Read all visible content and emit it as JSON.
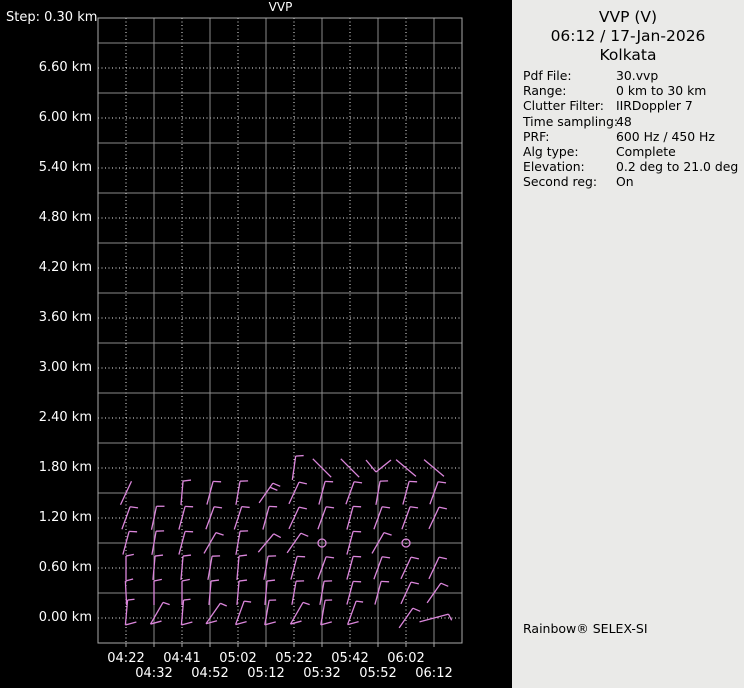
{
  "plot": {
    "title": "VVP",
    "step_label": "Step: 0.30 km",
    "y_axis": {
      "unit": "km",
      "labels": [
        "6.60 km",
        "6.00 km",
        "5.40 km",
        "4.80 km",
        "4.20 km",
        "3.60 km",
        "3.00 km",
        "2.40 km",
        "1.80 km",
        "1.20 km",
        "0.60 km",
        "0.00 km"
      ]
    },
    "x_axis": {
      "labels_row1": [
        "04:22",
        "04:41",
        "05:02",
        "05:22",
        "05:42",
        "06:02"
      ],
      "labels_row2": [
        "04:32",
        "04:52",
        "05:12",
        "05:32",
        "05:52",
        "06:12"
      ]
    }
  },
  "chart_data": {
    "type": "wind-barb-time-height-profile",
    "x_times": [
      "04:22",
      "04:32",
      "04:41",
      "04:52",
      "05:02",
      "05:12",
      "05:22",
      "05:32",
      "05:42",
      "05:52",
      "06:02",
      "06:12"
    ],
    "y_heights_km": [
      0.0,
      0.3,
      0.6,
      0.9,
      1.2,
      1.5,
      1.8
    ],
    "height_step_km": 0.3,
    "y_axis_range_km": [
      0.0,
      7.2
    ],
    "grid": "solid lines every 0.6 km / 20 min, dotted lines every 0.3 km / 10 min",
    "barb_note": "s=shape (barb: staff+tick, barb2: staff+2 ticks, line: plain staff, circle: calm, hook: staff+foot, dash: near-horizontal staff, vee: v-shape), a=staff tilt deg clockwise from vertical, t=time index, h=height km",
    "barbs": [
      {
        "h": 1.8,
        "t": 6,
        "s": "barb",
        "a": 8
      },
      {
        "h": 1.8,
        "t": 7,
        "s": "line",
        "a": -45
      },
      {
        "h": 1.8,
        "t": 8,
        "s": "line",
        "a": -45
      },
      {
        "h": 1.8,
        "t": 9,
        "s": "vee",
        "a": 0
      },
      {
        "h": 1.8,
        "t": 10,
        "s": "line",
        "a": -50
      },
      {
        "h": 1.8,
        "t": 11,
        "s": "line",
        "a": -50
      },
      {
        "h": 1.5,
        "t": 0,
        "s": "line",
        "a": 25
      },
      {
        "h": 1.5,
        "t": 2,
        "s": "barb",
        "a": 5
      },
      {
        "h": 1.5,
        "t": 3,
        "s": "barb",
        "a": 15
      },
      {
        "h": 1.5,
        "t": 4,
        "s": "barb",
        "a": 10
      },
      {
        "h": 1.5,
        "t": 5,
        "s": "barb2",
        "a": 35
      },
      {
        "h": 1.5,
        "t": 6,
        "s": "barb",
        "a": 25
      },
      {
        "h": 1.5,
        "t": 7,
        "s": "barb",
        "a": 15
      },
      {
        "h": 1.5,
        "t": 8,
        "s": "barb",
        "a": 20
      },
      {
        "h": 1.5,
        "t": 9,
        "s": "barb",
        "a": 10
      },
      {
        "h": 1.5,
        "t": 10,
        "s": "barb",
        "a": 15
      },
      {
        "h": 1.5,
        "t": 11,
        "s": "barb",
        "a": 20
      },
      {
        "h": 1.2,
        "t": 0,
        "s": "barb",
        "a": 20
      },
      {
        "h": 1.2,
        "t": 1,
        "s": "barb",
        "a": 12
      },
      {
        "h": 1.2,
        "t": 2,
        "s": "barb",
        "a": 15
      },
      {
        "h": 1.2,
        "t": 3,
        "s": "barb",
        "a": 20
      },
      {
        "h": 1.2,
        "t": 4,
        "s": "barb",
        "a": 18
      },
      {
        "h": 1.2,
        "t": 5,
        "s": "barb",
        "a": 15
      },
      {
        "h": 1.2,
        "t": 6,
        "s": "barb",
        "a": 25
      },
      {
        "h": 1.2,
        "t": 7,
        "s": "barb",
        "a": 20
      },
      {
        "h": 1.2,
        "t": 8,
        "s": "barb",
        "a": 15
      },
      {
        "h": 1.2,
        "t": 9,
        "s": "barb",
        "a": 20
      },
      {
        "h": 1.2,
        "t": 10,
        "s": "barb",
        "a": 20
      },
      {
        "h": 1.2,
        "t": 11,
        "s": "barb",
        "a": 25
      },
      {
        "h": 0.9,
        "t": 0,
        "s": "barb",
        "a": 15
      },
      {
        "h": 0.9,
        "t": 1,
        "s": "barb",
        "a": 10
      },
      {
        "h": 0.9,
        "t": 2,
        "s": "barb",
        "a": 15
      },
      {
        "h": 0.9,
        "t": 3,
        "s": "barb",
        "a": 30
      },
      {
        "h": 0.9,
        "t": 4,
        "s": "barb",
        "a": 10
      },
      {
        "h": 0.9,
        "t": 5,
        "s": "barb",
        "a": 40
      },
      {
        "h": 0.9,
        "t": 6,
        "s": "barb",
        "a": 35
      },
      {
        "h": 0.9,
        "t": 7,
        "s": "circle",
        "a": 0
      },
      {
        "h": 0.9,
        "t": 8,
        "s": "barb",
        "a": 15
      },
      {
        "h": 0.9,
        "t": 9,
        "s": "barb",
        "a": 30
      },
      {
        "h": 0.9,
        "t": 10,
        "s": "circle",
        "a": 0
      },
      {
        "h": 0.6,
        "t": 0,
        "s": "barb",
        "a": 0
      },
      {
        "h": 0.6,
        "t": 1,
        "s": "barb",
        "a": 5
      },
      {
        "h": 0.6,
        "t": 2,
        "s": "barb",
        "a": 5
      },
      {
        "h": 0.6,
        "t": 3,
        "s": "barb",
        "a": 10
      },
      {
        "h": 0.6,
        "t": 4,
        "s": "barb",
        "a": 5
      },
      {
        "h": 0.6,
        "t": 5,
        "s": "barb",
        "a": 10
      },
      {
        "h": 0.6,
        "t": 6,
        "s": "barb",
        "a": 15
      },
      {
        "h": 0.6,
        "t": 7,
        "s": "barb",
        "a": 20
      },
      {
        "h": 0.6,
        "t": 8,
        "s": "barb",
        "a": 15
      },
      {
        "h": 0.6,
        "t": 9,
        "s": "barb",
        "a": 20
      },
      {
        "h": 0.6,
        "t": 10,
        "s": "barb",
        "a": 25
      },
      {
        "h": 0.6,
        "t": 11,
        "s": "barb",
        "a": 25
      },
      {
        "h": 0.3,
        "t": 0,
        "s": "barb",
        "a": -3
      },
      {
        "h": 0.3,
        "t": 1,
        "s": "barb",
        "a": 0
      },
      {
        "h": 0.3,
        "t": 2,
        "s": "barb",
        "a": 0
      },
      {
        "h": 0.3,
        "t": 3,
        "s": "barb",
        "a": 5
      },
      {
        "h": 0.3,
        "t": 4,
        "s": "barb",
        "a": 5
      },
      {
        "h": 0.3,
        "t": 5,
        "s": "barb",
        "a": 5
      },
      {
        "h": 0.3,
        "t": 6,
        "s": "barb",
        "a": 10
      },
      {
        "h": 0.3,
        "t": 7,
        "s": "barb",
        "a": 10
      },
      {
        "h": 0.3,
        "t": 8,
        "s": "barb",
        "a": 15
      },
      {
        "h": 0.3,
        "t": 9,
        "s": "barb",
        "a": 15
      },
      {
        "h": 0.3,
        "t": 10,
        "s": "barb",
        "a": 25
      },
      {
        "h": 0.3,
        "t": 11,
        "s": "barb",
        "a": 35
      },
      {
        "h": 0.0,
        "t": 0,
        "s": "hook",
        "a": 5
      },
      {
        "h": 0.0,
        "t": 1,
        "s": "hook",
        "a": 30
      },
      {
        "h": 0.0,
        "t": 2,
        "s": "hook",
        "a": 5
      },
      {
        "h": 0.0,
        "t": 3,
        "s": "hook",
        "a": 35
      },
      {
        "h": 0.0,
        "t": 4,
        "s": "hook",
        "a": 20
      },
      {
        "h": 0.0,
        "t": 5,
        "s": "hook",
        "a": 10
      },
      {
        "h": 0.0,
        "t": 6,
        "s": "hook",
        "a": 30
      },
      {
        "h": 0.0,
        "t": 7,
        "s": "hook",
        "a": 10
      },
      {
        "h": 0.0,
        "t": 8,
        "s": "hook",
        "a": 20
      },
      {
        "h": 0.0,
        "t": 10,
        "s": "barb",
        "a": 35
      },
      {
        "h": 0.0,
        "t": 11,
        "s": "dash",
        "a": 75
      }
    ]
  },
  "panel": {
    "title": "VVP (V)",
    "datetime": "06:12 / 17-Jan-2026",
    "site": "Kolkata",
    "details": [
      {
        "label": "Pdf File:",
        "value": "30.vvp"
      },
      {
        "label": "Range:",
        "value": "0 km to 30 km"
      },
      {
        "label": "Clutter Filter:",
        "value": "IIRDoppler 7"
      },
      {
        "label": "Time sampling:",
        "value": "48"
      },
      {
        "label": "PRF:",
        "value": "600 Hz / 450 Hz"
      },
      {
        "label": "Alg type:",
        "value": "Complete"
      },
      {
        "label": "Elevation:",
        "value": "0.2 deg to 21.0 deg"
      },
      {
        "label": "Second reg:",
        "value": "On"
      }
    ],
    "footer": "Rainbow® SELEX-SI"
  },
  "colors": {
    "barb": "#db86db",
    "grid_solid": "#8a8a8a",
    "grid_dotted": "#ececec",
    "frame": "#aaaaaa",
    "plot_bg": "#000000",
    "panel_bg": "#eaeae8",
    "text_light": "#ffffff",
    "text_dark": "#000000"
  }
}
